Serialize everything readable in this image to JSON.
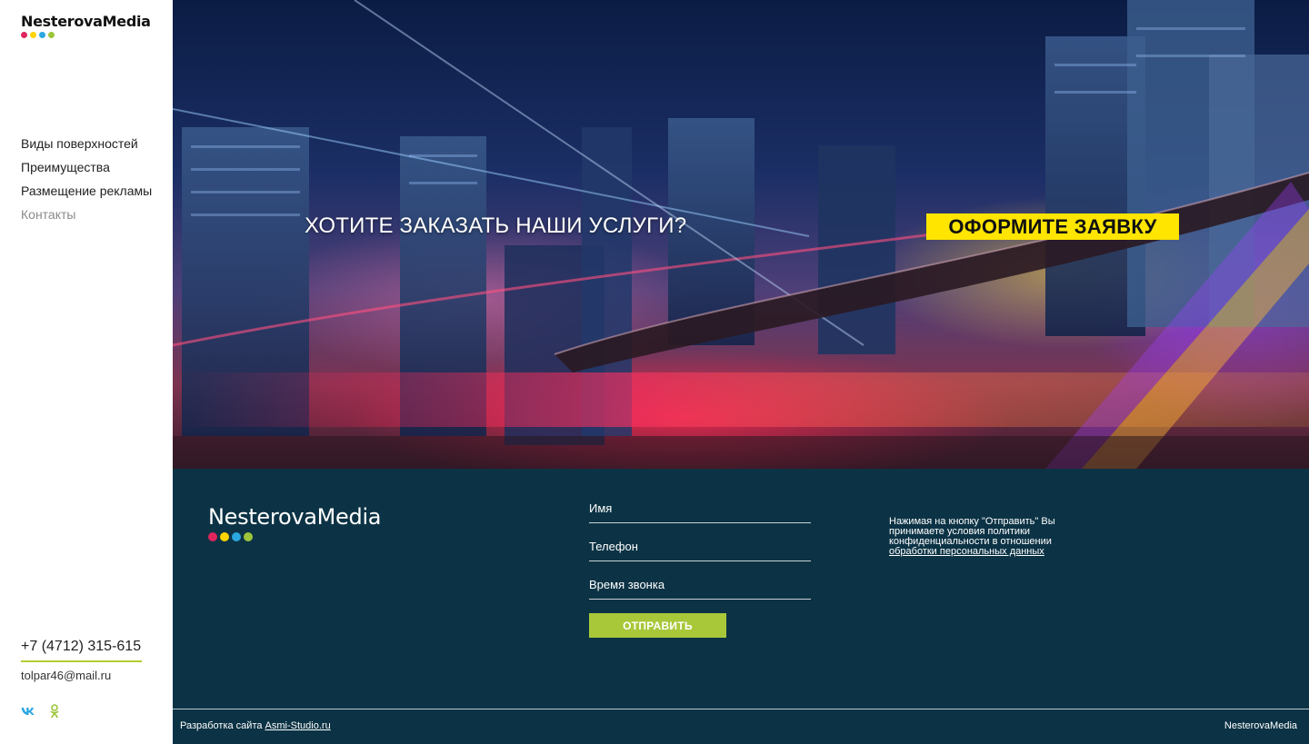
{
  "brand": {
    "name": "NesterovaMedia",
    "dot_colors": [
      "#e0245e",
      "#ffd400",
      "#2aa6e0",
      "#9cc53a"
    ]
  },
  "sidebar": {
    "nav": [
      {
        "label": "Виды поверхностей"
      },
      {
        "label": "Преимущества"
      },
      {
        "label": "Размещение рекламы"
      },
      {
        "label": "Контакты"
      }
    ],
    "phone": "+7 (4712) 315-615",
    "email": "tolpar46@mail.ru",
    "social_icons": [
      "vk-icon",
      "odnoklassniki-icon"
    ]
  },
  "hero": {
    "question": "ХОТИТЕ ЗАКАЗАТЬ НАШИ УСЛУГИ?",
    "cta_label": "ОФОРМИТЕ ЗАЯВКУ",
    "cta_color": "#ffe500"
  },
  "form": {
    "name_placeholder": "Имя",
    "phone_placeholder": "Телефон",
    "time_placeholder": "Время звонка",
    "submit_label": "ОТПРАВИТЬ",
    "submit_color": "#a8c83a"
  },
  "policy": {
    "text": "Нажимая на кнопку \"Отправить\" Вы принимаете условия политики конфиденциальности в отношении",
    "link": "обработки персональных данных"
  },
  "footer": {
    "background": "#0c3345",
    "credit_prefix": "Разработка сайта",
    "credit_link": "Asmi-Studio.ru",
    "brand": "NesterovaMedia"
  }
}
